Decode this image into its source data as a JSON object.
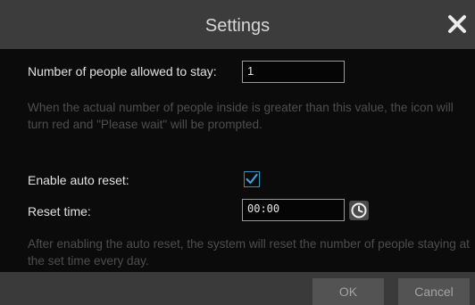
{
  "dialog": {
    "title": "Settings",
    "close_icon": "close-icon"
  },
  "people_limit": {
    "label": "Number of people allowed to stay:",
    "value": "1",
    "note": "When the actual number of people inside is greater than this value, the icon will turn red and \"Please wait\" will be prompted."
  },
  "auto_reset": {
    "label": "Enable auto reset:",
    "checked": true,
    "checkmark_icon": "checkmark-icon"
  },
  "reset_time": {
    "label": "Reset time:",
    "value": "00:00",
    "clock_icon": "clock-icon",
    "note": "After enabling the auto reset, the system will reset the number of people staying at the set time every day."
  },
  "footer": {
    "ok_label": "OK",
    "cancel_label": "Cancel"
  },
  "colors": {
    "title_bar": "#3c3c3c",
    "background": "#0b0b0b",
    "checkbox_accent": "#2c8fbf",
    "note_text": "#4e4e4e"
  }
}
